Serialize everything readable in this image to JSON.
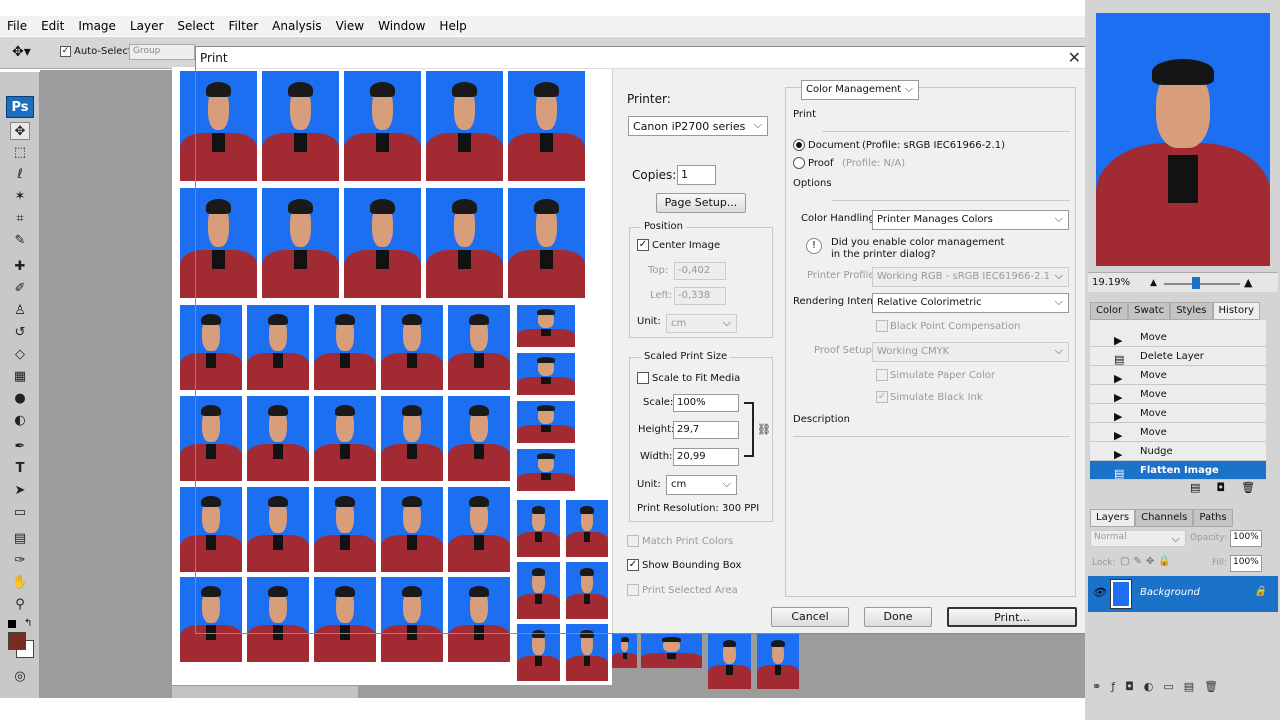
{
  "menubar": [
    "File",
    "Edit",
    "Image",
    "Layer",
    "Select",
    "Filter",
    "Analysis",
    "View",
    "Window",
    "Help"
  ],
  "options": {
    "auto_select_label": "Auto-Select:",
    "group_value": "Group"
  },
  "toolbar": {
    "logo": "Ps"
  },
  "dialog": {
    "title": "Print",
    "printer_label": "Printer:",
    "printer_value": "Canon iP2700 series",
    "copies_label": "Copies:",
    "copies_value": "1",
    "page_setup_label": "Page Setup...",
    "position": {
      "legend": "Position",
      "center_image_label": "Center Image",
      "top_label": "Top:",
      "top_value": "-0,402",
      "left_label": "Left:",
      "left_value": "-0,338",
      "unit_label": "Unit:",
      "unit_value": "cm"
    },
    "scaled": {
      "legend": "Scaled Print Size",
      "scale_to_fit_label": "Scale to Fit Media",
      "scale_label": "Scale:",
      "scale_value": "100%",
      "height_label": "Height:",
      "height_value": "29,7",
      "width_label": "Width:",
      "width_value": "20,99",
      "unit_label": "Unit:",
      "unit_value": "cm",
      "resolution_label": "Print Resolution: 300 PPI"
    },
    "match_print_colors_label": "Match Print Colors",
    "show_bounding_box_label": "Show Bounding Box",
    "print_selected_area_label": "Print Selected Area",
    "color_management": {
      "mode_value": "Color Management",
      "print_heading": "Print",
      "document_label": "Document",
      "document_profile": "(Profile: sRGB IEC61966-2.1)",
      "proof_label": "Proof",
      "proof_profile": "(Profile: N/A)",
      "options_heading": "Options",
      "color_handling_label": "Color Handling:",
      "color_handling_value": "Printer Manages Colors",
      "warning_text_1": "Did you enable color management",
      "warning_text_2": "in the printer dialog?",
      "printer_profile_label": "Printer Profile:",
      "printer_profile_value": "Working RGB - sRGB IEC61966-2.1",
      "rendering_intent_label": "Rendering Intent:",
      "rendering_intent_value": "Relative Colorimetric",
      "black_point_label": "Black Point Compensation",
      "proof_setup_label": "Proof Setup:",
      "proof_setup_value": "Working CMYK",
      "simulate_paper_label": "Simulate Paper Color",
      "simulate_black_label": "Simulate Black Ink",
      "description_heading": "Description"
    },
    "buttons": {
      "cancel": "Cancel",
      "done": "Done",
      "print": "Print..."
    }
  },
  "navigator": {
    "zoom": "19.19%"
  },
  "history_tabs": [
    "Color",
    "Swatc",
    "Styles",
    "History"
  ],
  "history_items": [
    "Move",
    "Delete Layer",
    "Move",
    "Move",
    "Move",
    "Move",
    "Nudge",
    "Flatten Image"
  ],
  "layers_tabs": [
    "Layers",
    "Channels",
    "Paths"
  ],
  "layers": {
    "blend_mode": "Normal",
    "opacity_label": "Opacity:",
    "opacity_value": "100%",
    "lock_label": "Lock:",
    "fill_label": "Fill:",
    "fill_value": "100%",
    "layer_name": "Background"
  },
  "colors": {
    "accent": "#1a73c8",
    "photo_bg": "#1c6ff0",
    "shirt": "#a22a33",
    "fg_swatch": "#7a2a22"
  }
}
